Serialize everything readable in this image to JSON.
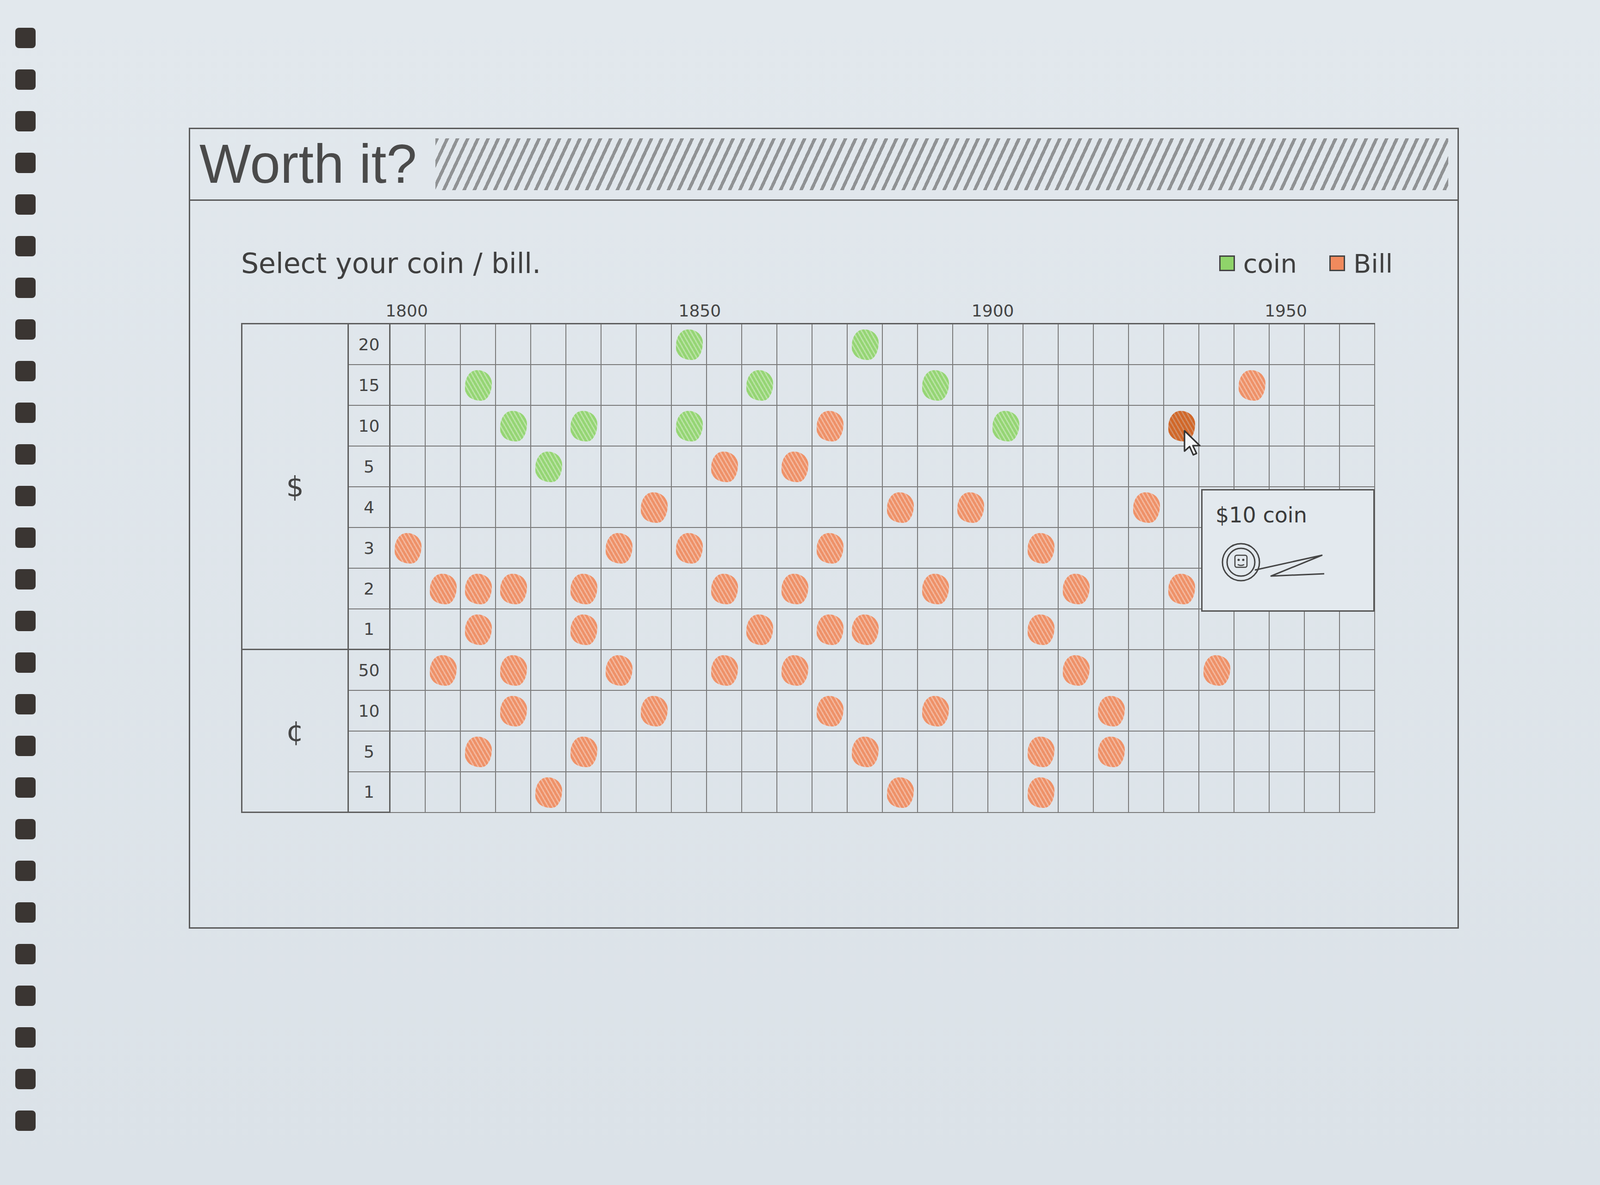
{
  "window": {
    "title": "Worth it?"
  },
  "prompt": "Select your coin / bill.",
  "chart": {
    "x_ticks": [
      "1800",
      "1850",
      "1900",
      "1950"
    ],
    "y_groups": [
      {
        "unit": "$",
        "ticks": [
          {
            "label": "20",
            "value": 20
          },
          {
            "label": "15",
            "value": 15
          },
          {
            "label": "10",
            "value": 10
          },
          {
            "label": "5",
            "value": 5
          },
          {
            "label": "4",
            "value": 4
          },
          {
            "label": "3",
            "value": 3
          },
          {
            "label": "2",
            "value": 2
          },
          {
            "label": "1",
            "value": 1
          }
        ]
      },
      {
        "unit": "¢",
        "ticks": [
          {
            "label": "50",
            "value": 0.5
          },
          {
            "label": "10",
            "value": 0.1
          },
          {
            "label": "5",
            "value": 0.05
          },
          {
            "label": "1",
            "value": 0.01
          }
        ]
      }
    ],
    "series": [
      {
        "name": "coin",
        "color": "#8fd46a",
        "points": [
          {
            "year": 1848,
            "value": 20,
            "selected": false
          },
          {
            "year": 1878,
            "value": 20,
            "selected": false
          },
          {
            "year": 1812,
            "value": 15,
            "selected": false
          },
          {
            "year": 1860,
            "value": 15,
            "selected": false
          },
          {
            "year": 1890,
            "value": 15,
            "selected": false
          },
          {
            "year": 1818,
            "value": 10,
            "selected": false
          },
          {
            "year": 1830,
            "value": 10,
            "selected": false
          },
          {
            "year": 1848,
            "value": 10,
            "selected": false
          },
          {
            "year": 1902,
            "value": 10,
            "selected": false
          },
          {
            "year": 1824,
            "value": 5,
            "selected": false
          }
        ]
      },
      {
        "name": "Bill",
        "color": "#f08a5d",
        "points": [
          {
            "year": 1944,
            "value": 15,
            "selected": false
          },
          {
            "year": 1872,
            "value": 10,
            "selected": false
          },
          {
            "year": 1932,
            "value": 10,
            "selected": true
          },
          {
            "year": 1854,
            "value": 5,
            "selected": false
          },
          {
            "year": 1866,
            "value": 5,
            "selected": false
          },
          {
            "year": 1842,
            "value": 4,
            "selected": false
          },
          {
            "year": 1884,
            "value": 4,
            "selected": false
          },
          {
            "year": 1896,
            "value": 4,
            "selected": false
          },
          {
            "year": 1926,
            "value": 4,
            "selected": false
          },
          {
            "year": 1800,
            "value": 3,
            "selected": false
          },
          {
            "year": 1836,
            "value": 3,
            "selected": false
          },
          {
            "year": 1848,
            "value": 3,
            "selected": false
          },
          {
            "year": 1872,
            "value": 3,
            "selected": false
          },
          {
            "year": 1908,
            "value": 3,
            "selected": false
          },
          {
            "year": 1806,
            "value": 2,
            "selected": false
          },
          {
            "year": 1812,
            "value": 2,
            "selected": false
          },
          {
            "year": 1818,
            "value": 2,
            "selected": false
          },
          {
            "year": 1830,
            "value": 2,
            "selected": false
          },
          {
            "year": 1854,
            "value": 2,
            "selected": false
          },
          {
            "year": 1866,
            "value": 2,
            "selected": false
          },
          {
            "year": 1890,
            "value": 2,
            "selected": false
          },
          {
            "year": 1914,
            "value": 2,
            "selected": false
          },
          {
            "year": 1932,
            "value": 2,
            "selected": false
          },
          {
            "year": 1812,
            "value": 1,
            "selected": false
          },
          {
            "year": 1830,
            "value": 1,
            "selected": false
          },
          {
            "year": 1860,
            "value": 1,
            "selected": false
          },
          {
            "year": 1872,
            "value": 1,
            "selected": false
          },
          {
            "year": 1878,
            "value": 1,
            "selected": false
          },
          {
            "year": 1908,
            "value": 1,
            "selected": false
          },
          {
            "year": 1806,
            "value": 0.5,
            "selected": false
          },
          {
            "year": 1818,
            "value": 0.5,
            "selected": false
          },
          {
            "year": 1836,
            "value": 0.5,
            "selected": false
          },
          {
            "year": 1854,
            "value": 0.5,
            "selected": false
          },
          {
            "year": 1866,
            "value": 0.5,
            "selected": false
          },
          {
            "year": 1914,
            "value": 0.5,
            "selected": false
          },
          {
            "year": 1938,
            "value": 0.5,
            "selected": false
          },
          {
            "year": 1818,
            "value": 0.1,
            "selected": false
          },
          {
            "year": 1842,
            "value": 0.1,
            "selected": false
          },
          {
            "year": 1872,
            "value": 0.1,
            "selected": false
          },
          {
            "year": 1890,
            "value": 0.1,
            "selected": false
          },
          {
            "year": 1920,
            "value": 0.1,
            "selected": false
          },
          {
            "year": 1812,
            "value": 0.05,
            "selected": false
          },
          {
            "year": 1830,
            "value": 0.05,
            "selected": false
          },
          {
            "year": 1878,
            "value": 0.05,
            "selected": false
          },
          {
            "year": 1908,
            "value": 0.05,
            "selected": false
          },
          {
            "year": 1920,
            "value": 0.05,
            "selected": false
          },
          {
            "year": 1824,
            "value": 0.01,
            "selected": false
          },
          {
            "year": 1884,
            "value": 0.01,
            "selected": false
          },
          {
            "year": 1908,
            "value": 0.01,
            "selected": false
          }
        ]
      }
    ]
  },
  "tooltip": {
    "label": "$10 coin"
  }
}
